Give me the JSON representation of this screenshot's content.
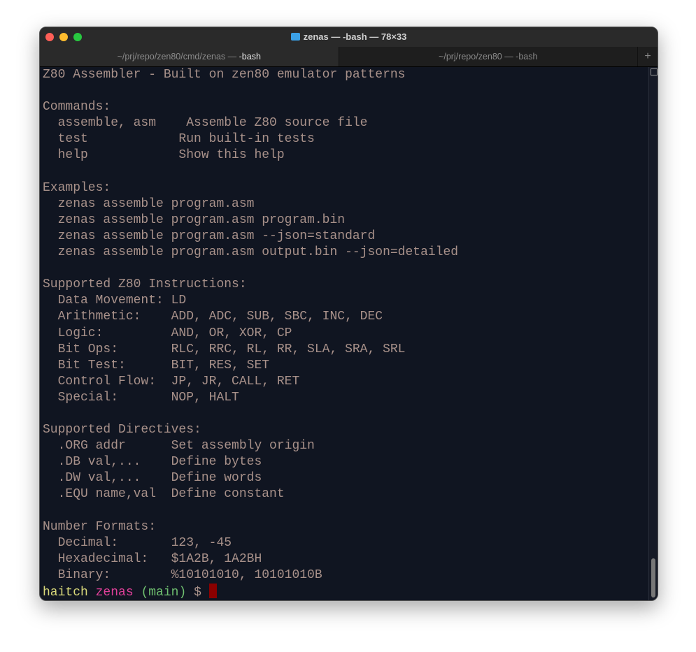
{
  "window": {
    "title": "zenas — -bash — 78×33"
  },
  "tabs": [
    {
      "path": "~/prj/repo/zen80/cmd/zenas — ",
      "proc": "-bash",
      "active": true
    },
    {
      "path": "~/prj/repo/zen80 — -bash",
      "active": false
    }
  ],
  "tab_add": "+",
  "lines": [
    "Z80 Assembler - Built on zen80 emulator patterns",
    "",
    "Commands:",
    "  assemble, asm    Assemble Z80 source file",
    "  test            Run built-in tests",
    "  help            Show this help",
    "",
    "Examples:",
    "  zenas assemble program.asm",
    "  zenas assemble program.asm program.bin",
    "  zenas assemble program.asm --json=standard",
    "  zenas assemble program.asm output.bin --json=detailed",
    "",
    "Supported Z80 Instructions:",
    "  Data Movement: LD",
    "  Arithmetic:    ADD, ADC, SUB, SBC, INC, DEC",
    "  Logic:         AND, OR, XOR, CP",
    "  Bit Ops:       RLC, RRC, RL, RR, SLA, SRA, SRL",
    "  Bit Test:      BIT, RES, SET",
    "  Control Flow:  JP, JR, CALL, RET",
    "  Special:       NOP, HALT",
    "",
    "Supported Directives:",
    "  .ORG addr      Set assembly origin",
    "  .DB val,...    Define bytes",
    "  .DW val,...    Define words",
    "  .EQU name,val  Define constant",
    "",
    "Number Formats:",
    "  Decimal:       123, -45",
    "  Hexadecimal:   $1A2B, 1A2BH",
    "  Binary:        %10101010, 10101010B"
  ],
  "prompt": {
    "user": "haitch",
    "dir": "zenas",
    "branch": "(main)",
    "symbol": "$"
  },
  "colors": {
    "background": "#101521",
    "text": "#a8918a",
    "user": "#d8d87a",
    "dir": "#e0409a",
    "branch": "#6fbf6f",
    "cursor": "#8b0000"
  }
}
